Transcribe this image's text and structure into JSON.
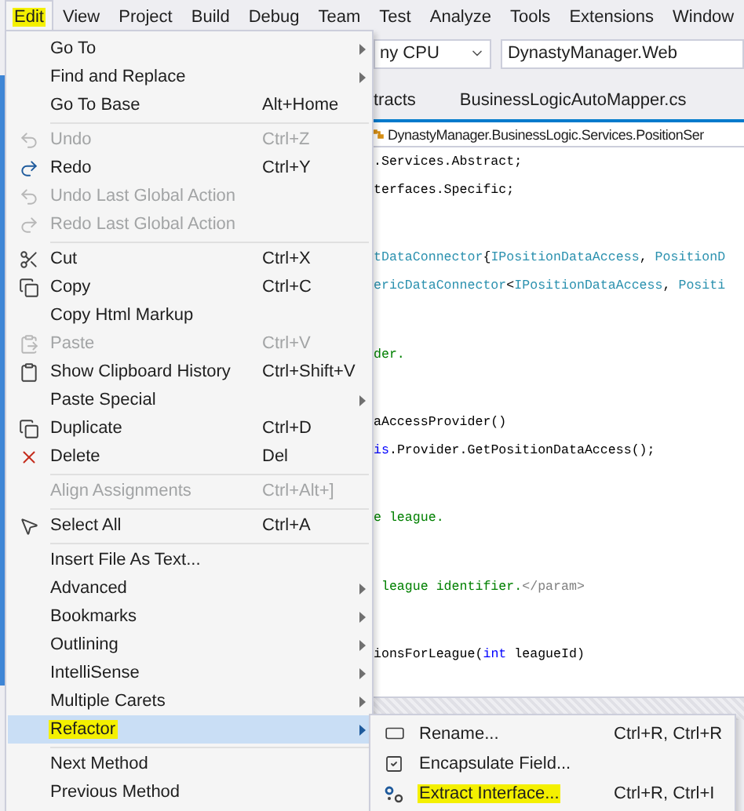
{
  "menu_bar": {
    "items": [
      {
        "label": "Edit",
        "selected": true,
        "marked": true
      },
      {
        "label": "View",
        "selected": false,
        "marked": false
      },
      {
        "label": "Project",
        "selected": false,
        "marked": false
      },
      {
        "label": "Build",
        "selected": false,
        "marked": false
      },
      {
        "label": "Debug",
        "selected": false,
        "marked": false
      },
      {
        "label": "Team",
        "selected": false,
        "marked": false
      },
      {
        "label": "Test",
        "selected": false,
        "marked": false
      },
      {
        "label": "Analyze",
        "selected": false,
        "marked": false
      },
      {
        "label": "Tools",
        "selected": false,
        "marked": false
      },
      {
        "label": "Extensions",
        "selected": false,
        "marked": false
      },
      {
        "label": "Window",
        "selected": false,
        "marked": false
      }
    ]
  },
  "toolbar": {
    "platform": "ny CPU",
    "startup_project": "DynastyManager.Web"
  },
  "tabs": [
    {
      "label": "tracts"
    },
    {
      "label": "BusinessLogicAutoMapper.cs"
    }
  ],
  "navigation_bar": "DynastyManager.BusinessLogic.Services.PositionSer",
  "code_blocks": [
    [
      [
        {
          "kind": "plain",
          "text": ".Services.Abstract;"
        }
      ],
      [
        {
          "kind": "plain",
          "text": "terfaces.Specific;"
        }
      ]
    ],
    [
      [
        {
          "kind": "type",
          "text": "tDataConnector"
        },
        {
          "kind": "plain",
          "text": "{"
        },
        {
          "kind": "type",
          "text": "IPositionDataAccess"
        },
        {
          "kind": "plain",
          "text": ", "
        },
        {
          "kind": "type",
          "text": "PositionD"
        }
      ],
      [
        {
          "kind": "type",
          "text": "ericDataConnector"
        },
        {
          "kind": "plain",
          "text": "<"
        },
        {
          "kind": "type",
          "text": "IPositionDataAccess"
        },
        {
          "kind": "plain",
          "text": ", "
        },
        {
          "kind": "type",
          "text": "Positi"
        }
      ]
    ],
    [
      [
        {
          "kind": "comment",
          "text": "der."
        }
      ]
    ],
    [
      [
        {
          "kind": "plain",
          "text": "aAccessProvider()"
        }
      ],
      [
        {
          "kind": "keyword",
          "text": "is"
        },
        {
          "kind": "plain",
          "text": ".Provider.GetPositionDataAccess();"
        }
      ]
    ],
    [
      [
        {
          "kind": "comment",
          "text": "e league."
        }
      ]
    ],
    [
      [
        {
          "kind": "comment",
          "text": " league identifier."
        },
        {
          "kind": "doctag",
          "text": "</param>"
        }
      ]
    ],
    [
      [
        {
          "kind": "plain",
          "text": "ionsForLeague("
        },
        {
          "kind": "keyword",
          "text": "int"
        },
        {
          "kind": "plain",
          "text": " leagueId)"
        }
      ]
    ]
  ],
  "edit_menu": [
    [
      {
        "label": "Go To",
        "submenu": true,
        "disabled": false,
        "selected": false,
        "marked": false
      },
      {
        "label": "Find and Replace",
        "submenu": true,
        "disabled": false,
        "selected": false,
        "marked": false
      },
      {
        "label": "Go To Base",
        "shortcut": "Alt+Home",
        "submenu": false,
        "disabled": false,
        "selected": false,
        "marked": false
      }
    ],
    [
      {
        "label": "Undo",
        "shortcut": "Ctrl+Z",
        "submenu": false,
        "disabled": true,
        "selected": false,
        "marked": false
      },
      {
        "label": "Redo",
        "shortcut": "Ctrl+Y",
        "submenu": false,
        "disabled": false,
        "selected": false,
        "marked": false
      },
      {
        "label": "Undo Last Global Action",
        "submenu": false,
        "disabled": true,
        "selected": false,
        "marked": false
      },
      {
        "label": "Redo Last Global Action",
        "submenu": false,
        "disabled": true,
        "selected": false,
        "marked": false
      }
    ],
    [
      {
        "label": "Cut",
        "shortcut": "Ctrl+X",
        "submenu": false,
        "disabled": false,
        "selected": false,
        "marked": false
      },
      {
        "label": "Copy",
        "shortcut": "Ctrl+C",
        "submenu": false,
        "disabled": false,
        "selected": false,
        "marked": false
      },
      {
        "label": "Copy Html Markup",
        "submenu": false,
        "disabled": false,
        "selected": false,
        "marked": false
      },
      {
        "label": "Paste",
        "shortcut": "Ctrl+V",
        "submenu": false,
        "disabled": true,
        "selected": false,
        "marked": false
      },
      {
        "label": "Show Clipboard History",
        "shortcut": "Ctrl+Shift+V",
        "submenu": false,
        "disabled": false,
        "selected": false,
        "marked": false
      },
      {
        "label": "Paste Special",
        "submenu": true,
        "disabled": false,
        "selected": false,
        "marked": false
      },
      {
        "label": "Duplicate",
        "shortcut": "Ctrl+D",
        "submenu": false,
        "disabled": false,
        "selected": false,
        "marked": false
      },
      {
        "label": "Delete",
        "shortcut": "Del",
        "submenu": false,
        "disabled": false,
        "selected": false,
        "marked": false
      }
    ],
    [
      {
        "label": "Align Assignments",
        "shortcut": "Ctrl+Alt+]",
        "submenu": false,
        "disabled": true,
        "selected": false,
        "marked": false
      }
    ],
    [
      {
        "label": "Select All",
        "shortcut": "Ctrl+A",
        "submenu": false,
        "disabled": false,
        "selected": false,
        "marked": false
      }
    ],
    [
      {
        "label": "Insert File As Text...",
        "submenu": false,
        "disabled": false,
        "selected": false,
        "marked": false
      },
      {
        "label": "Advanced",
        "submenu": true,
        "disabled": false,
        "selected": false,
        "marked": false
      },
      {
        "label": "Bookmarks",
        "submenu": true,
        "disabled": false,
        "selected": false,
        "marked": false
      },
      {
        "label": "Outlining",
        "submenu": true,
        "disabled": false,
        "selected": false,
        "marked": false
      },
      {
        "label": "IntelliSense",
        "submenu": true,
        "disabled": false,
        "selected": false,
        "marked": false
      },
      {
        "label": "Multiple Carets",
        "submenu": true,
        "disabled": false,
        "selected": false,
        "marked": false
      },
      {
        "label": "Refactor",
        "submenu": true,
        "disabled": false,
        "selected": true,
        "marked": true
      }
    ],
    [
      {
        "label": "Next Method",
        "submenu": false,
        "disabled": false,
        "selected": false,
        "marked": false
      },
      {
        "label": "Previous Method",
        "submenu": false,
        "disabled": false,
        "selected": false,
        "marked": false
      }
    ]
  ],
  "refactor_menu": [
    {
      "label": "Rename...",
      "shortcut": "Ctrl+R, Ctrl+R",
      "marked": false
    },
    {
      "label": "Encapsulate Field...",
      "marked": false
    },
    {
      "label": "Extract Interface...",
      "shortcut": "Ctrl+R, Ctrl+I",
      "marked": true
    }
  ]
}
